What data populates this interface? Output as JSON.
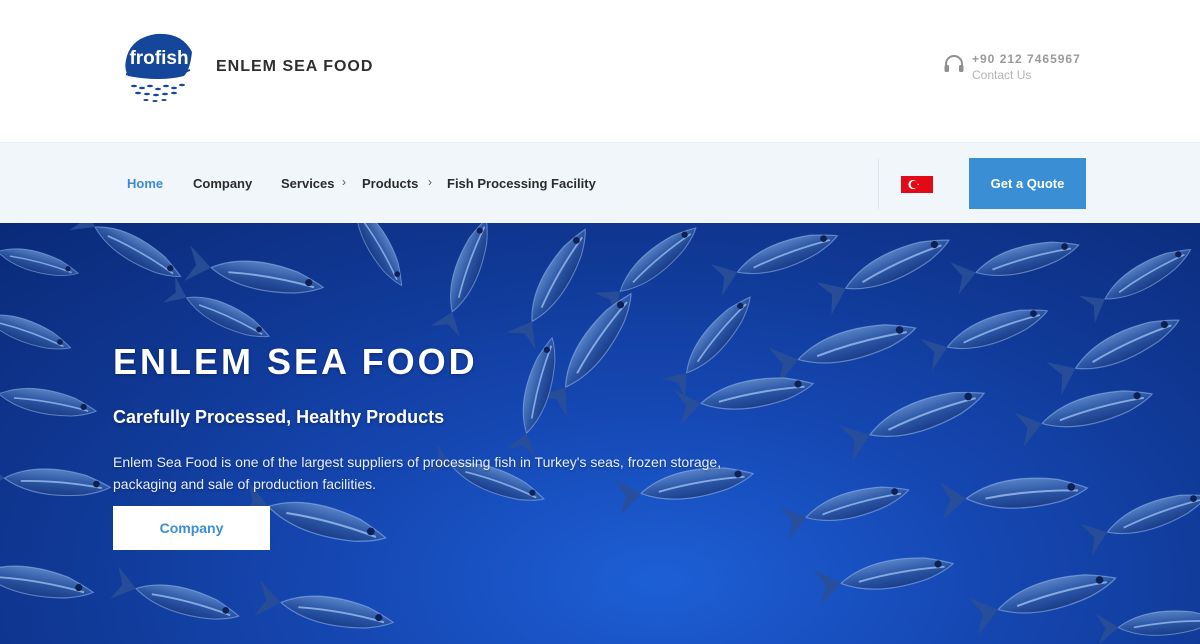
{
  "header": {
    "logo_text": "frofish",
    "brand": "ENLEM SEA FOOD",
    "contact": {
      "icon": "headset-icon",
      "phone": "+90 212 7465967",
      "label": "Contact Us"
    }
  },
  "nav": {
    "items": [
      {
        "label": "Home",
        "active": true
      },
      {
        "label": "Company",
        "active": false
      },
      {
        "label": "Services",
        "active": false,
        "has_submenu": true
      },
      {
        "label": "Products",
        "active": false,
        "has_submenu": true
      },
      {
        "label": "Fish Processing Facility",
        "active": false
      }
    ],
    "submenu_glyph": "›",
    "language_flag": "turkey-flag-icon",
    "quote_button": "Get a Quote"
  },
  "hero": {
    "title": "ENLEM SEA FOOD",
    "subtitle": "Carefully Processed, Healthy Products",
    "text": "Enlem Sea Food is one of the largest suppliers of processing fish in Turkey's seas, frozen storage, packaging and sale of production facilities.",
    "button": "Company",
    "background": "school-of-fish-underwater"
  },
  "colors": {
    "accent": "#3a8fd4",
    "nav_active": "#3d8bd0",
    "nav_background": "#f1f6fb",
    "logo_blue": "#14479a",
    "hero_blue": "#1547b2"
  }
}
